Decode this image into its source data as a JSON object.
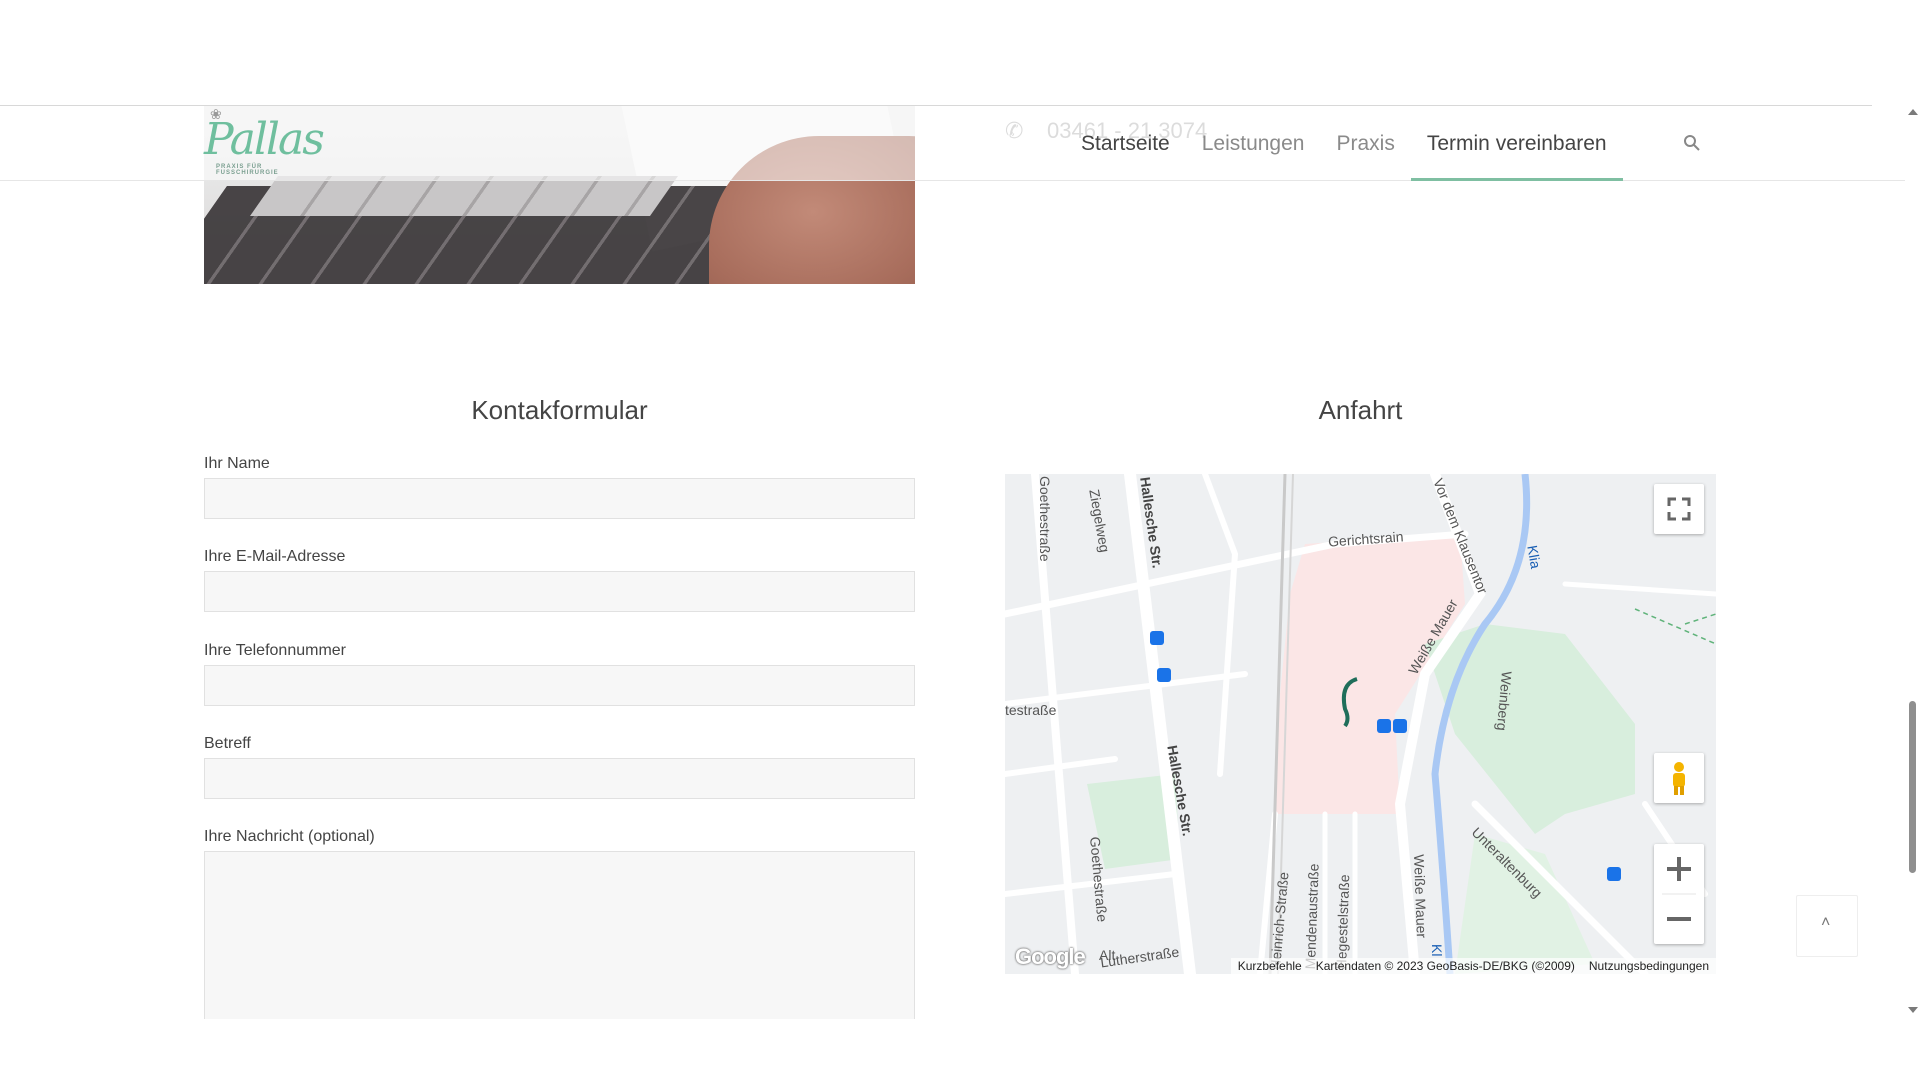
{
  "header": {
    "logo_text": "Pallas",
    "logo_subtext": "PRAXIS FÜR FUSSCHIRURGIE",
    "phone_partial": "03461 - 21 3074",
    "nav": [
      {
        "label": "Startseite"
      },
      {
        "label": "Leistungen"
      },
      {
        "label": "Praxis"
      },
      {
        "label": "Termin vereinbaren"
      }
    ],
    "search_icon": "search-icon"
  },
  "contact": {
    "title": "Kontakformular",
    "fields": [
      {
        "label": "Ihr Name",
        "value": ""
      },
      {
        "label": "Ihre E-Mail-Adresse",
        "value": ""
      },
      {
        "label": "Ihre Telefonnummer",
        "value": ""
      },
      {
        "label": "Betreff",
        "value": ""
      },
      {
        "label": "Ihre Nachricht (optional)",
        "value": ""
      }
    ]
  },
  "directions": {
    "title": "Anfahrt",
    "map": {
      "streets": [
        "Goethestraße",
        "Ziegelweg",
        "Hallesche Str.",
        "Gerichtsrain",
        "Vor dem Klausentor",
        "Klia",
        "Weiße Mauer",
        "Weinberg",
        "testraße",
        "Hallesche Str.",
        "Unteraltenburg",
        "Goethestraße",
        "Lutherstraße",
        "Heinrich-Straße",
        "Mendenaustraße",
        "Hegestelstraße",
        "Weiße Mauer",
        "Kl",
        "Alt"
      ],
      "logo": "Google",
      "footer": {
        "shortcuts": "Kurzbefehle",
        "map_data": "Kartendaten © 2023 GeoBasis-DE/BKG (©2009)",
        "terms": "Nutzungsbedingungen"
      },
      "controls": [
        "fullscreen-icon",
        "pegman-icon",
        "zoom-in-icon",
        "zoom-out-icon"
      ]
    }
  },
  "back_to_top": "chevron-up-icon",
  "colors": {
    "accent": "#7fbfa2",
    "logo": "#6fbf9e",
    "input_bg": "#f7f7f7"
  }
}
